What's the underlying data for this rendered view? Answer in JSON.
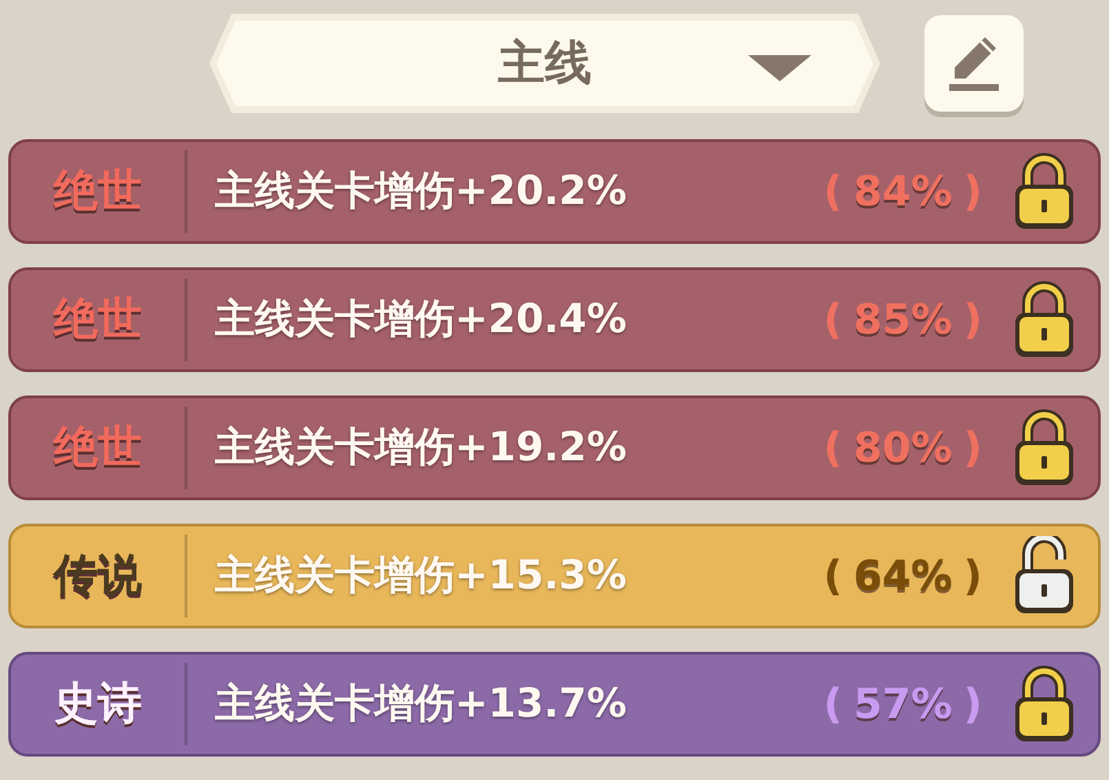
{
  "selector": {
    "label": "主线"
  },
  "rows": [
    {
      "tier": "绝世",
      "kind": "mythic",
      "effect": "主线关卡增伤+20.2%",
      "open": "(",
      "percent": "84%",
      "close": ")",
      "locked": true
    },
    {
      "tier": "绝世",
      "kind": "mythic",
      "effect": "主线关卡增伤+20.4%",
      "open": "(",
      "percent": "85%",
      "close": ")",
      "locked": true
    },
    {
      "tier": "绝世",
      "kind": "mythic",
      "effect": "主线关卡增伤+19.2%",
      "open": "(",
      "percent": "80%",
      "close": ")",
      "locked": true
    },
    {
      "tier": "传说",
      "kind": "legendary",
      "effect": "主线关卡增伤+15.3%",
      "open": "(",
      "percent": "64%",
      "close": ")",
      "locked": false
    },
    {
      "tier": "史诗",
      "kind": "epic",
      "effect": "主线关卡增伤+13.7%",
      "open": "(",
      "percent": "57%",
      "close": ")",
      "locked": true
    }
  ]
}
